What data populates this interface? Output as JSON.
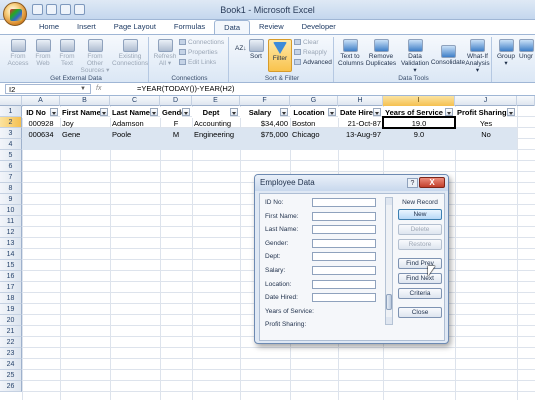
{
  "window": {
    "title": "Book1 - Microsoft Excel"
  },
  "tabs": [
    "Home",
    "Insert",
    "Page Layout",
    "Formulas",
    "Data",
    "Review",
    "Developer"
  ],
  "active_tab": "Data",
  "ribbon": {
    "get_external": {
      "label": "Get External Data",
      "from_access": "From Access",
      "from_web": "From Web",
      "from_text": "From Text",
      "from_other": "From Other Sources ▾",
      "existing": "Existing Connections"
    },
    "connections": {
      "label": "Connections",
      "refresh": "Refresh All ▾",
      "connections": "Connections",
      "properties": "Properties",
      "edit_links": "Edit Links"
    },
    "sort_filter": {
      "label": "Sort & Filter",
      "sort": "Sort",
      "filter": "Filter",
      "clear": "Clear",
      "reapply": "Reapply",
      "advanced": "Advanced"
    },
    "data_tools": {
      "label": "Data Tools",
      "text_to_columns": "Text to Columns",
      "remove_duplicates": "Remove Duplicates",
      "data_validation": "Data Validation ▾",
      "consolidate": "Consolidate",
      "what_if": "What-If Analysis ▾"
    },
    "outline": {
      "group": "Group ▾",
      "ungroup": "Ungr"
    }
  },
  "formula_bar": {
    "name_box": "I2",
    "formula": "=YEAR(TODAY())-YEAR(H2)"
  },
  "columns": [
    "A",
    "B",
    "C",
    "D",
    "E",
    "F",
    "G",
    "H",
    "I",
    "J"
  ],
  "selected_column": "I",
  "rows": [
    "1",
    "2",
    "3",
    "4",
    "5",
    "6",
    "7",
    "8",
    "9",
    "10",
    "11",
    "12",
    "13",
    "14",
    "15",
    "16",
    "17",
    "18",
    "19",
    "20",
    "21",
    "22",
    "23",
    "24",
    "25",
    "26"
  ],
  "headers": [
    "ID No",
    "First Name",
    "Last Name",
    "Gender",
    "Dept",
    "Salary",
    "Location",
    "Date Hired",
    "Years of Service",
    "Profit Sharing"
  ],
  "records": [
    [
      "000928",
      "Joy",
      "Adamson",
      "F",
      "Accounting",
      "$34,400",
      "Boston",
      "21-Oct-87",
      "19.0",
      "Yes"
    ],
    [
      "000634",
      "Gene",
      "Poole",
      "M",
      "Engineering",
      "$75,000",
      "Chicago",
      "13-Aug-97",
      "9.0",
      "No"
    ]
  ],
  "dialog": {
    "title": "Employee Data",
    "help": "?",
    "close": "X",
    "fields": [
      "ID No:",
      "First Name:",
      "Last Name:",
      "Gender:",
      "Dept:",
      "Salary:",
      "Location:",
      "Date Hired:",
      "Years of Service:",
      "Profit Sharing:"
    ],
    "record_status": "New Record",
    "buttons": {
      "new": "New",
      "delete": "Delete",
      "restore": "Restore",
      "find_prev": "Find Prev",
      "find_next": "Find Next",
      "criteria": "Criteria",
      "close": "Close"
    }
  }
}
